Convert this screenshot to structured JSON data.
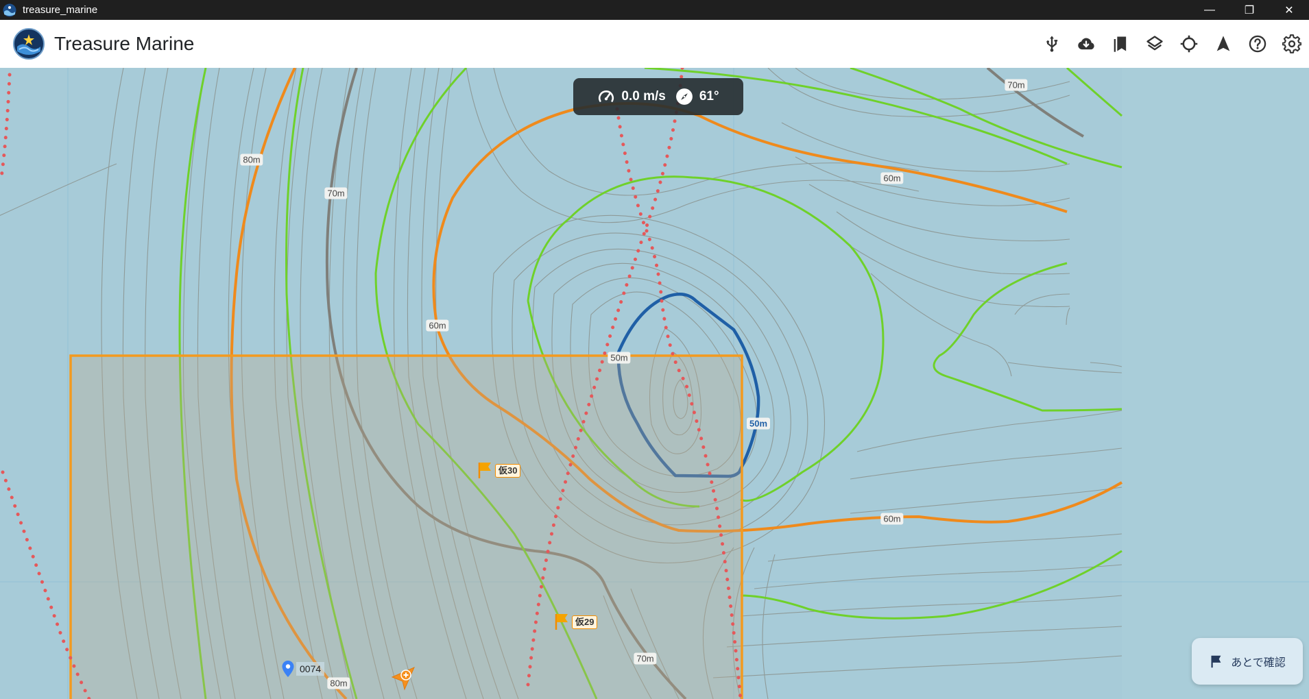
{
  "window": {
    "title": "treasure_marine",
    "controls": {
      "minimize": "—",
      "restore": "❐",
      "close": "✕"
    }
  },
  "header": {
    "app_name": "Treasure Marine",
    "toolbar_icons": [
      "usb-icon",
      "cloud-download-icon",
      "bookmarks-icon",
      "layers-icon",
      "crosshair-icon",
      "navigation-arrow-icon",
      "help-icon",
      "settings-icon"
    ]
  },
  "nav_status": {
    "speed": "0.0 m/s",
    "heading": "61°"
  },
  "depth_labels": [
    {
      "id": "d1",
      "text": "70m"
    },
    {
      "id": "d2",
      "text": "80m"
    },
    {
      "id": "d3",
      "text": "70m"
    },
    {
      "id": "d4",
      "text": "60m"
    },
    {
      "id": "d5",
      "text": "60m"
    },
    {
      "id": "d6",
      "text": "50m"
    },
    {
      "id": "d7",
      "text": "50m"
    },
    {
      "id": "d8",
      "text": "60m"
    },
    {
      "id": "d9",
      "text": "70m"
    },
    {
      "id": "d10",
      "text": "80m"
    }
  ],
  "markers": {
    "flags": [
      {
        "label": "仮30"
      },
      {
        "label": "仮29"
      }
    ],
    "pin": {
      "label": "0074"
    }
  },
  "later_confirm": {
    "label": "あとで確認"
  },
  "colors": {
    "water": "#a7cbd8",
    "contour_minor": "#8e9a98",
    "contour_green": "#6fd12a",
    "contour_orange": "#ef8a1c",
    "contour_gray": "#7f7f7a",
    "contour_blue": "#1f5fa6",
    "track_dots": "#e5585a",
    "selection_box": "#f39a1f"
  }
}
